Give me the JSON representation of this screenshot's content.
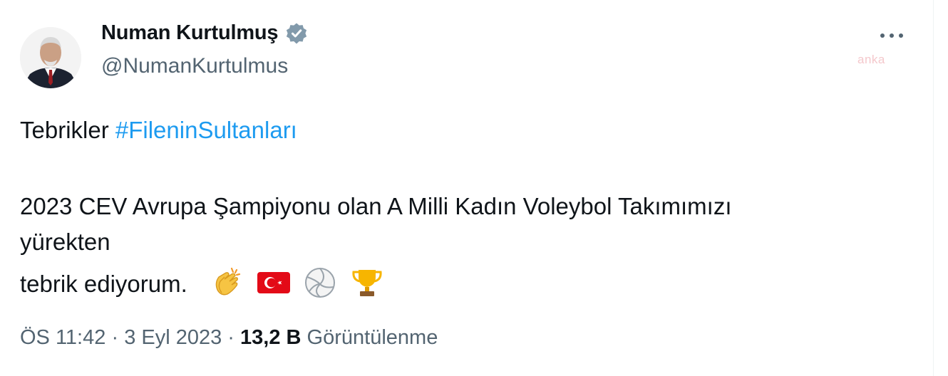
{
  "author": {
    "name": "Numan Kurtulmuş",
    "handle": "@NumanKurtulmus",
    "verified_icon": "verified-badge-icon"
  },
  "watermark": "anka",
  "tweet": {
    "greeting": "Tebrikler",
    "hashtag": "#FileninSultanları",
    "line2": "2023 CEV Avrupa Şampiyonu olan A Milli Kadın Voleybol Takımımızı",
    "line3": "yürekten",
    "line4": "tebrik ediyorum.",
    "emojis": [
      "clapping-hands-icon",
      "turkey-flag-icon",
      "volleyball-icon",
      "trophy-icon"
    ]
  },
  "meta": {
    "time": "ÖS 11:42",
    "date": "3 Eyl 2023",
    "separator": "·",
    "views_count": "13,2 B",
    "views_label": "Görüntülenme"
  },
  "colors": {
    "link": "#1d9bf0",
    "secondary_text": "#536471",
    "verified_badge": "#829aab"
  }
}
